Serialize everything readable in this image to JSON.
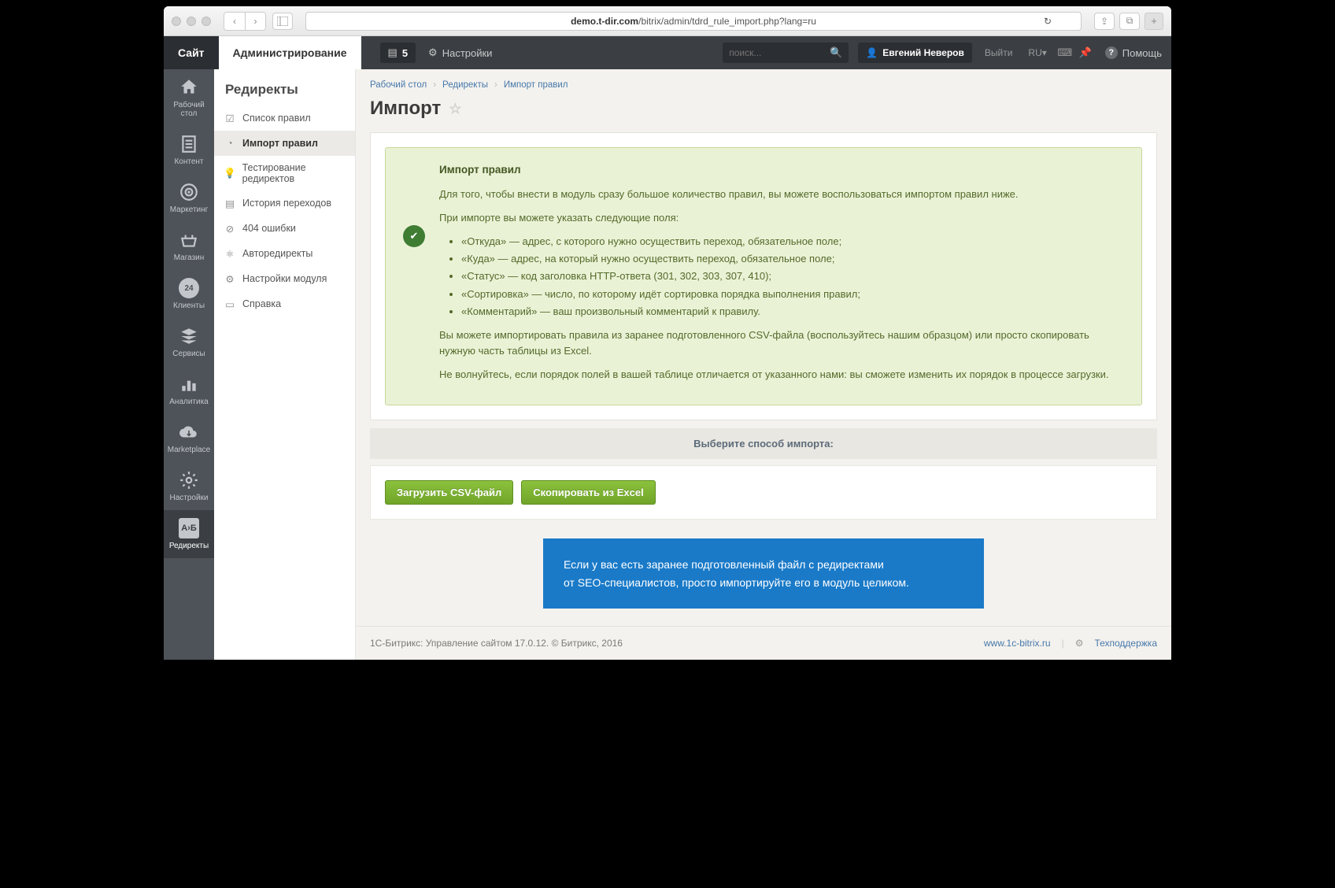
{
  "browser": {
    "url_host": "demo.t-dir.com",
    "url_path": "/bitrix/admin/tdrd_rule_import.php?lang=ru"
  },
  "topbar": {
    "tab_site": "Сайт",
    "tab_admin": "Администрирование",
    "notif_count": "5",
    "settings": "Настройки",
    "search_placeholder": "поиск...",
    "user": "Евгений Неверов",
    "logout": "Выйти",
    "lang": "RU",
    "help": "Помощь"
  },
  "rail": [
    {
      "label": "Рабочий стол"
    },
    {
      "label": "Контент"
    },
    {
      "label": "Маркетинг"
    },
    {
      "label": "Магазин"
    },
    {
      "label": "Клиенты"
    },
    {
      "label": "Сервисы"
    },
    {
      "label": "Аналитика"
    },
    {
      "label": "Marketplace"
    },
    {
      "label": "Настройки"
    },
    {
      "label": "Редиректы"
    }
  ],
  "rail_active_badge": "А›Б",
  "nav": {
    "title": "Редиректы",
    "items": [
      "Список правил",
      "Импорт правил",
      "Тестирование редиректов",
      "История переходов",
      "404 ошибки",
      "Авторедиректы",
      "Настройки модуля",
      "Справка"
    ]
  },
  "crumbs": [
    "Рабочий стол",
    "Редиректы",
    "Импорт правил"
  ],
  "page_title": "Импорт",
  "notice": {
    "heading": "Импорт правил",
    "p1": "Для того, чтобы внести в модуль сразу большое количество правил, вы можете воспользоваться импортом правил ниже.",
    "p2": "При импорте вы можете указать следующие поля:",
    "fields": [
      "«Откуда» — адрес, с которого нужно осуществить переход, обязательное поле;",
      "«Куда» — адрес, на который нужно осуществить переход, обязательное поле;",
      "«Статус» — код заголовка HTTP-ответа (301, 302, 303, 307, 410);",
      "«Сортировка» — число, по которому идёт сортировка порядка выполнения правил;",
      "«Комментарий» — ваш произвольный комментарий к правилу."
    ],
    "p3": "Вы можете импортировать правила из заранее подготовленного CSV-файла (воспользуйтесь нашим образцом) или просто скопировать нужную часть таблицы из Excel.",
    "p4": "Не волнуйтесь, если порядок полей в вашей таблице отличается от указанного нами: вы сможете изменить их порядок в процессе загрузки."
  },
  "import_head": "Выберите способ импорта:",
  "buttons": {
    "csv": "Загрузить CSV-файл",
    "excel": "Скопировать из Excel"
  },
  "callout": {
    "l1": "Если у вас есть заранее подготовленный файл с редиректами",
    "l2": "от SEO-специалистов, просто импортируйте его в модуль целиком."
  },
  "footer": {
    "left": "1С-Битрикс: Управление сайтом 17.0.12. © Битрикс, 2016",
    "link": "www.1c-bitrix.ru",
    "support": "Техподдержка"
  }
}
